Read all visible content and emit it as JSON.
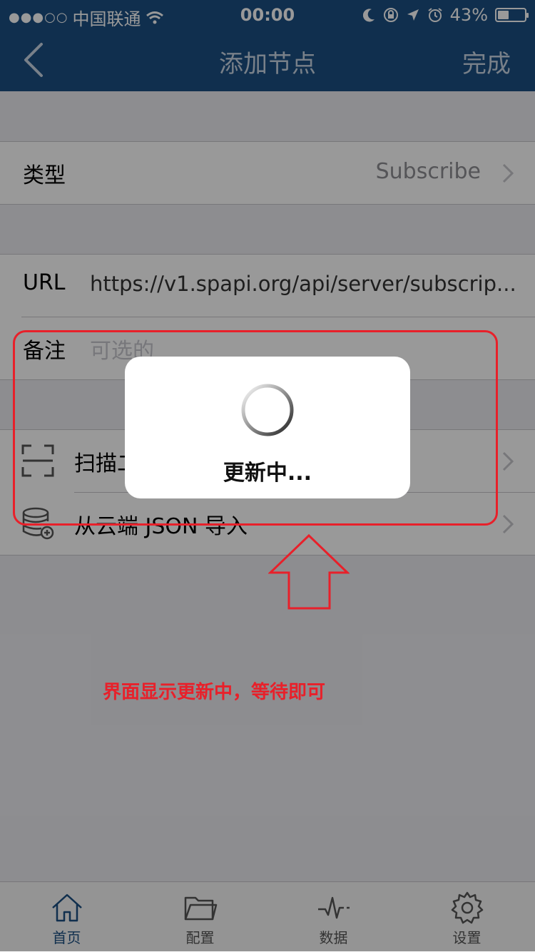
{
  "status_bar": {
    "signal": "●●●○○",
    "carrier": "中国联通",
    "time": "00:00",
    "battery": "43%",
    "battery_level": 0.43
  },
  "navbar": {
    "back_icon": "chevron-left-icon",
    "title": "添加节点",
    "done_label": "完成"
  },
  "form": {
    "type_label": "类型",
    "type_value": "Subscribe",
    "url_label": "URL",
    "url_value": "https://v1.spapi.org/api/server/subscrip...",
    "note_label": "备注",
    "note_placeholder": "可选的"
  },
  "menu": {
    "scan_label": "扫描二",
    "scan_icon": "scan-qr-icon",
    "cloud_label": "从云端 JSON 导入",
    "cloud_icon": "database-add-icon"
  },
  "hud": {
    "message": "更新中..."
  },
  "annotation": {
    "text": "界面显示更新中，等待即可",
    "color": "#e8202a"
  },
  "tabs": [
    {
      "label": "首页",
      "icon": "home-icon",
      "active": true
    },
    {
      "label": "配置",
      "icon": "folder-icon",
      "active": false
    },
    {
      "label": "数据",
      "icon": "pulse-icon",
      "active": false
    },
    {
      "label": "设置",
      "icon": "gear-icon",
      "active": false
    }
  ],
  "colors": {
    "nav": "#1b4f82",
    "background": "#ececf1",
    "accent": "#1b4f82",
    "annotation": "#e8202a"
  }
}
